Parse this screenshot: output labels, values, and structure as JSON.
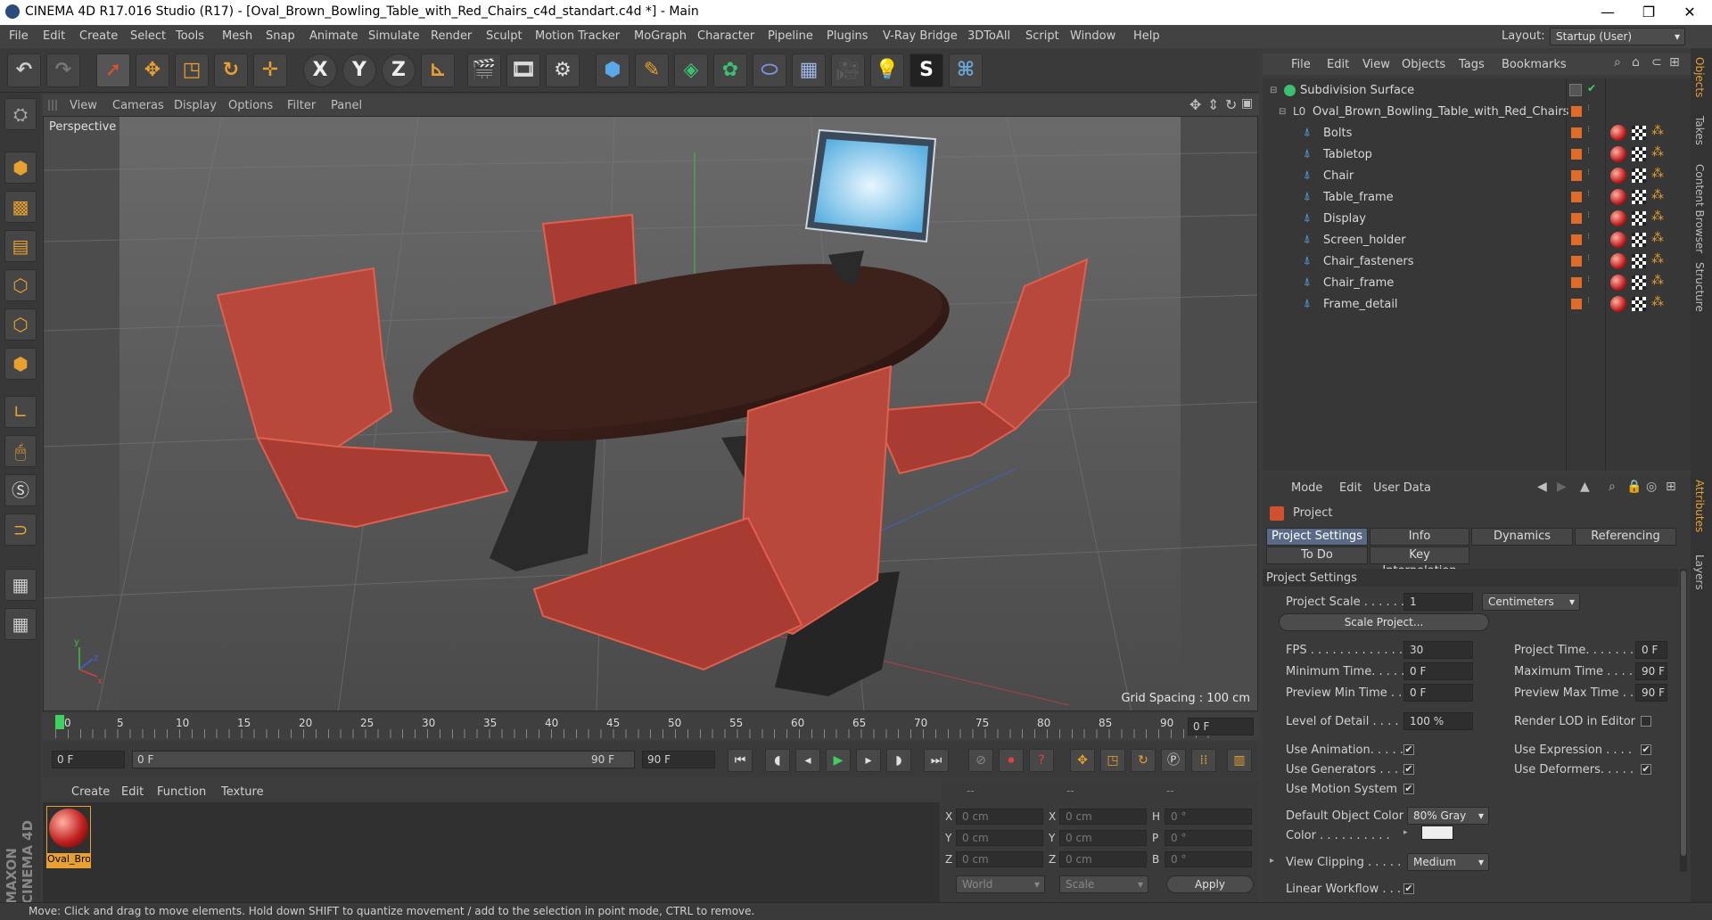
{
  "window": {
    "title": "CINEMA 4D R17.016 Studio (R17) - [Oval_Brown_Bowling_Table_with_Red_Chairs_c4d_standart.c4d *] - Main",
    "layout_label": "Layout:",
    "layout_value": "Startup (User)"
  },
  "menu": [
    "File",
    "Edit",
    "Create",
    "Select",
    "Tools",
    "Mesh",
    "Snap",
    "Animate",
    "Simulate",
    "Render",
    "Sculpt",
    "Motion Tracker",
    "MoGraph",
    "Character",
    "Pipeline",
    "Plugins",
    "V-Ray Bridge",
    "3DToAll",
    "Script",
    "Window",
    "Help"
  ],
  "viewport": {
    "menu": [
      "View",
      "Cameras",
      "Display",
      "Options",
      "Filter",
      "Panel"
    ],
    "label": "Perspective",
    "grid_spacing": "Grid Spacing : 100 cm"
  },
  "timeline": {
    "ticks": [
      "0",
      "5",
      "10",
      "15",
      "20",
      "25",
      "30",
      "35",
      "40",
      "45",
      "50",
      "55",
      "60",
      "65",
      "70",
      "75",
      "80",
      "85",
      "90"
    ],
    "end_field": "0 F",
    "start": "0 F",
    "range_start": "0 F",
    "range_end": "90 F",
    "end": "90 F"
  },
  "material_manager": {
    "menu": [
      "Create",
      "Edit",
      "Function",
      "Texture"
    ],
    "material_label": "Oval_Bro"
  },
  "coordinates": {
    "headers": [
      "--",
      "--",
      "--"
    ],
    "pos": [
      {
        "axis": "X",
        "value": "0 cm"
      },
      {
        "axis": "Y",
        "value": "0 cm"
      },
      {
        "axis": "Z",
        "value": "0 cm"
      }
    ],
    "size": [
      {
        "axis": "X",
        "value": "0 cm"
      },
      {
        "axis": "Y",
        "value": "0 cm"
      },
      {
        "axis": "Z",
        "value": "0 cm"
      }
    ],
    "rot": [
      {
        "axis": "H",
        "value": "0 °"
      },
      {
        "axis": "P",
        "value": "0 °"
      },
      {
        "axis": "B",
        "value": "0 °"
      }
    ],
    "mode1": "World",
    "mode2": "Scale",
    "apply": "Apply"
  },
  "status": "Move: Click and drag to move elements. Hold down SHIFT to quantize movement / add to the selection in point mode, CTRL to remove.",
  "object_manager": {
    "menu": [
      "File",
      "Edit",
      "View",
      "Objects",
      "Tags",
      "Bookmarks"
    ],
    "root": "Subdivision Surface",
    "group": "Oval_Brown_Bowling_Table_with_Red_Chairs",
    "children": [
      "Bolts",
      "Tabletop",
      "Chair",
      "Table_frame",
      "Display",
      "Screen_holder",
      "Chair_fasteners",
      "Chair_frame",
      "Frame_detail"
    ]
  },
  "attributes": {
    "menu": [
      "Mode",
      "Edit",
      "User Data"
    ],
    "title": "Project",
    "tabs": [
      "Project Settings",
      "Info",
      "Dynamics",
      "Referencing",
      "To Do",
      "Key Interpolation"
    ],
    "section": "Project Settings",
    "project_scale_label": "Project Scale . . . . . .",
    "project_scale": "1",
    "project_scale_unit": "Centimeters",
    "scale_project": "Scale Project...",
    "fps_label": "FPS . . . . . . . . . . . . . .",
    "fps": "30",
    "project_time_label": "Project Time. . . . . . .",
    "project_time": "0 F",
    "min_time_label": "Minimum Time. . . . . .",
    "min_time": "0 F",
    "max_time_label": "Maximum Time . . . .",
    "max_time": "90 F",
    "prev_min_label": "Preview Min Time . .",
    "prev_min": "0 F",
    "prev_max_label": "Preview Max Time . .",
    "prev_max": "90 F",
    "lod_label": "Level of Detail . . . . .",
    "lod": "100 %",
    "render_lod_label": "Render LOD in Editor",
    "use_anim_label": "Use Animation. . . . .",
    "use_expr_label": "Use Expression . . . .",
    "use_gen_label": "Use Generators . . . .",
    "use_def_label": "Use Deformers. . . . .",
    "use_motion_label": "Use Motion System",
    "default_color_label": "Default Object Color",
    "default_color": "80% Gray",
    "color_label": "Color . . . . . . . . . .",
    "view_clip_label": "View Clipping . . . . .",
    "view_clip": "Medium",
    "linear_label": "Linear Workflow . . ."
  },
  "right_tabs": [
    "Objects",
    "Takes",
    "Content Browser",
    "Structure",
    "Attributes",
    "Layers"
  ]
}
